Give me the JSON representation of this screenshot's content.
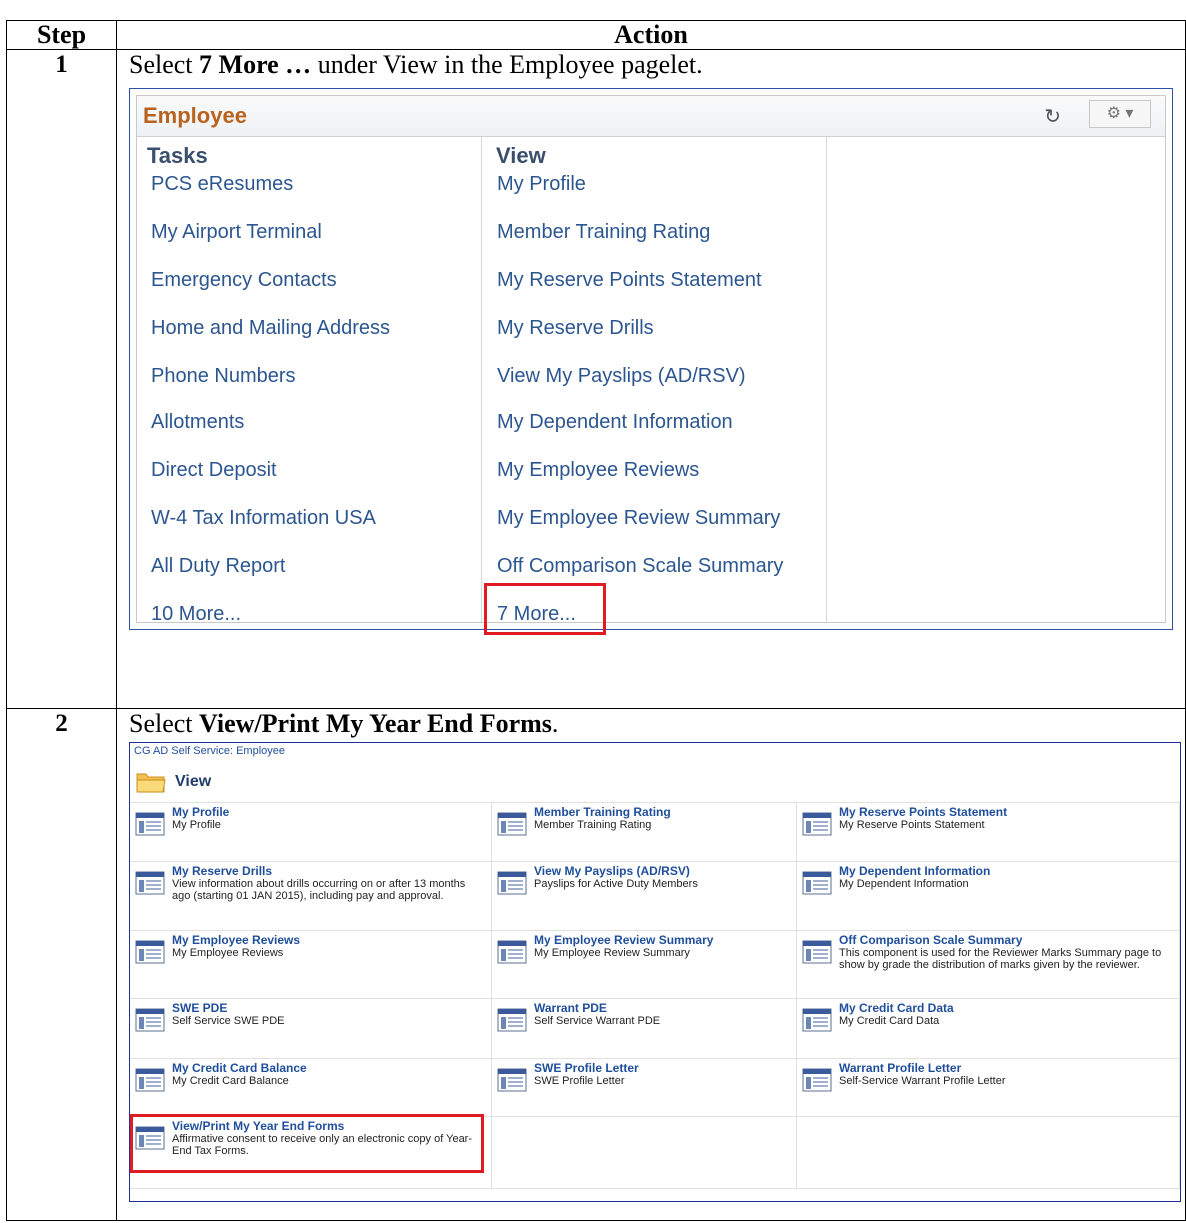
{
  "table": {
    "col_step": "Step",
    "col_action": "Action"
  },
  "step1": {
    "number": "1",
    "text_pre": "Select ",
    "text_bold": "7 More …",
    "text_post": " under View in the Employee pagelet.",
    "pagelet": {
      "title": "Employee",
      "tasks_header": "Tasks",
      "view_header": "View",
      "tasks": [
        "PCS eResumes",
        "My Airport Terminal",
        "Emergency Contacts",
        "Home and Mailing Address",
        "Phone Numbers",
        "Allotments",
        "Direct Deposit",
        "W-4 Tax Information USA",
        "All Duty Report",
        "10 More..."
      ],
      "view": [
        "My Profile",
        "Member Training Rating",
        "My Reserve Points Statement",
        "My Reserve Drills",
        "View My Payslips (AD/RSV)",
        "My Dependent Information",
        "My Employee Reviews",
        "My Employee Review Summary",
        "Off Comparison Scale Summary",
        "7 More..."
      ],
      "refresh_icon": "refresh-icon",
      "gear_icon": "gear-icon"
    }
  },
  "step2": {
    "number": "2",
    "text_pre": "Select ",
    "text_bold": "View/Print My Year End Forms",
    "text_post": ".",
    "panel": {
      "breadcrumb": "CG AD Self Service: Employee",
      "title": "View",
      "items": [
        {
          "title": "My Profile",
          "desc": "My Profile"
        },
        {
          "title": "Member Training Rating",
          "desc": "Member Training Rating"
        },
        {
          "title": "My Reserve Points Statement",
          "desc": "My Reserve Points Statement"
        },
        {
          "title": "My Reserve Drills",
          "desc": "View information about drills occurring on or after 13 months ago (starting 01 JAN 2015), including pay and approval."
        },
        {
          "title": "View My Payslips (AD/RSV)",
          "desc": "Payslips for Active Duty Members"
        },
        {
          "title": "My Dependent Information",
          "desc": "My Dependent Information"
        },
        {
          "title": "My Employee Reviews",
          "desc": "My Employee Reviews"
        },
        {
          "title": "My Employee Review Summary",
          "desc": "My Employee Review Summary"
        },
        {
          "title": "Off Comparison Scale Summary",
          "desc": "This component is used for the Reviewer Marks Summary page to show by grade the distribution of marks given by the reviewer."
        },
        {
          "title": "SWE PDE",
          "desc": "Self Service SWE PDE"
        },
        {
          "title": "Warrant PDE",
          "desc": "Self Service Warrant PDE"
        },
        {
          "title": "My Credit Card Data",
          "desc": "My Credit Card Data"
        },
        {
          "title": "My Credit Card Balance",
          "desc": "My Credit Card Balance"
        },
        {
          "title": "SWE Profile Letter",
          "desc": "SWE Profile Letter"
        },
        {
          "title": "Warrant Profile Letter",
          "desc": "Self-Service Warrant Profile Letter"
        },
        {
          "title": "View/Print My Year End Forms",
          "desc": "Affirmative consent to receive only an electronic copy of Year-End Tax Forms."
        }
      ]
    }
  }
}
